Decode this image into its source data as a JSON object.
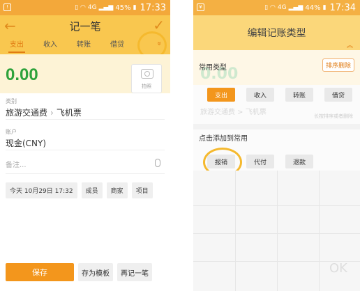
{
  "left": {
    "status": {
      "battery": "45%",
      "time": "17:33",
      "network": "4G"
    },
    "header": {
      "title": "记一笔"
    },
    "tabs": [
      "支出",
      "收入",
      "转账",
      "借贷"
    ],
    "amount": "0.00",
    "photo_label": "拍照",
    "category": {
      "label": "类别",
      "parent": "旅游交通费",
      "child": "飞机票"
    },
    "account": {
      "label": "账户",
      "value": "现金(CNY)"
    },
    "note": {
      "placeholder": "备注..."
    },
    "chips": [
      "今天 10月29日 17:32",
      "成员",
      "商家",
      "项目"
    ],
    "buttons": {
      "save": "保存",
      "template": "存为模板",
      "again": "再记一笔"
    },
    "colors": {
      "accent": "#f3961c",
      "header": "#f9c74f",
      "amount": "#2ea23b"
    }
  },
  "right": {
    "status": {
      "battery": "44%",
      "time": "17:34",
      "network": "4G"
    },
    "header": {
      "title": "编辑记账类型"
    },
    "common": {
      "title": "常用类型",
      "sort_label": "排序删除",
      "items": [
        "支出",
        "收入",
        "转账",
        "借贷"
      ]
    },
    "add": {
      "title": "点击添加到常用",
      "items": [
        "报销",
        "代付",
        "退款"
      ]
    },
    "ghost": {
      "amount": "0.00",
      "category": "旅游交通费 > 飞机票",
      "hint": "长按排序或者删除",
      "ok": "OK"
    }
  }
}
